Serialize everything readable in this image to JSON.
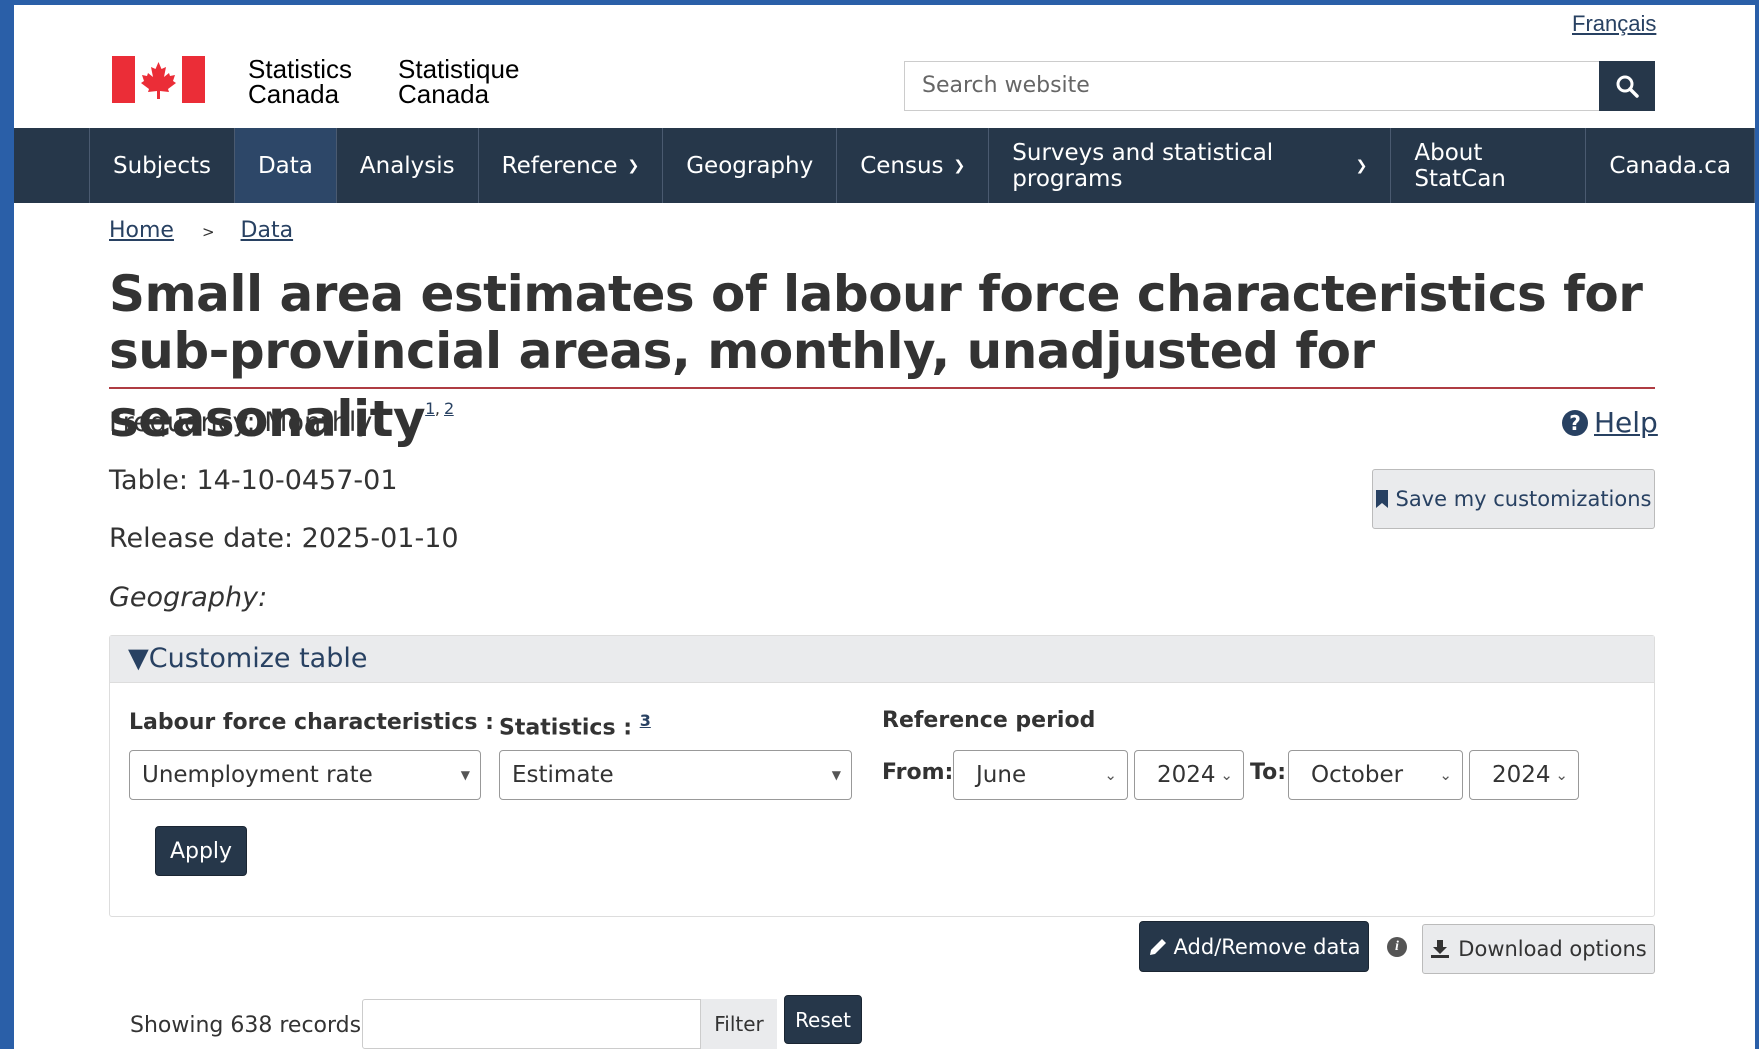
{
  "header": {
    "language_link": "Français",
    "signature_en_line1": "Statistics",
    "signature_en_line2": "Canada",
    "signature_fr_line1": "Statistique",
    "signature_fr_line2": "Canada",
    "search_placeholder": "Search website",
    "flag_colors": {
      "red": "#eb2d37",
      "white": "#ffffff"
    }
  },
  "nav": {
    "items": [
      {
        "label": "Subjects",
        "dropdown": false
      },
      {
        "label": "Data",
        "dropdown": false,
        "active": true
      },
      {
        "label": "Analysis",
        "dropdown": false
      },
      {
        "label": "Reference",
        "dropdown": true
      },
      {
        "label": "Geography",
        "dropdown": false
      },
      {
        "label": "Census",
        "dropdown": true
      },
      {
        "label": "Surveys and statistical programs",
        "dropdown": true
      },
      {
        "label": "About StatCan",
        "dropdown": false
      },
      {
        "label": "Canada.ca",
        "dropdown": false
      }
    ]
  },
  "breadcrumb": {
    "home": "Home",
    "separator": ">",
    "data": "Data"
  },
  "title": {
    "text": "Small area estimates of labour force characteristics for sub-provincial areas, monthly, unadjusted for seasonality",
    "footnote1": "1",
    "footnote_sep": ",",
    "footnote2": "2"
  },
  "meta": {
    "frequency": "Frequency: Monthly",
    "table": "Table: 14-10-0457-01",
    "release_date": "Release date: 2025-01-10",
    "geography": "Geography:"
  },
  "help_label": "Help",
  "save_label": "Save my customizations",
  "customize": {
    "heading": "▼Customize table",
    "labour_label": "Labour force characteristics :",
    "labour_value": "Unemployment rate",
    "statistics_label": "Statistics :",
    "statistics_footnote": "3",
    "statistics_value": "Estimate",
    "ref_period_label": "Reference period",
    "from_label": "From:",
    "from_month": "June",
    "from_year": "2024",
    "to_label": "To:",
    "to_month": "October",
    "to_year": "2024",
    "apply_label": "Apply"
  },
  "actions": {
    "add_remove_label": "Add/Remove data",
    "download_label": "Download options"
  },
  "table_controls": {
    "records_text": "Showing 638 records",
    "filter_label": "Filter",
    "reset_label": "Reset"
  },
  "colors": {
    "nav_bg": "#26374a",
    "link": "#284162",
    "title_rule": "#af3c43",
    "frame": "#2a5fa8"
  }
}
